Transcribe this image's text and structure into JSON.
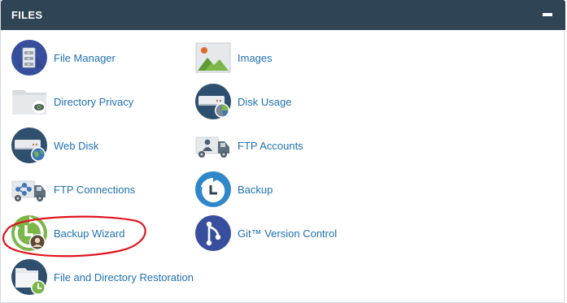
{
  "panel": {
    "title": "FILES",
    "collapse_icon": "minus-icon"
  },
  "items": {
    "file_manager": {
      "label": "File Manager",
      "icon": "file-manager-icon"
    },
    "images": {
      "label": "Images",
      "icon": "images-icon"
    },
    "directory_privacy": {
      "label": "Directory Privacy",
      "icon": "directory-privacy-icon"
    },
    "disk_usage": {
      "label": "Disk Usage",
      "icon": "disk-usage-icon"
    },
    "web_disk": {
      "label": "Web Disk",
      "icon": "web-disk-icon"
    },
    "ftp_accounts": {
      "label": "FTP Accounts",
      "icon": "ftp-accounts-icon"
    },
    "ftp_connections": {
      "label": "FTP Connections",
      "icon": "ftp-connections-icon"
    },
    "backup": {
      "label": "Backup",
      "icon": "backup-icon"
    },
    "backup_wizard": {
      "label": "Backup Wizard",
      "icon": "backup-wizard-icon"
    },
    "git_version_control": {
      "label": "Git™ Version Control",
      "icon": "git-icon"
    },
    "file_restoration": {
      "label": "File and Directory Restoration",
      "icon": "file-restoration-icon"
    }
  },
  "colors": {
    "header_bg": "#2f4455",
    "link": "#1f70b0",
    "annotation": "#e0141e"
  }
}
